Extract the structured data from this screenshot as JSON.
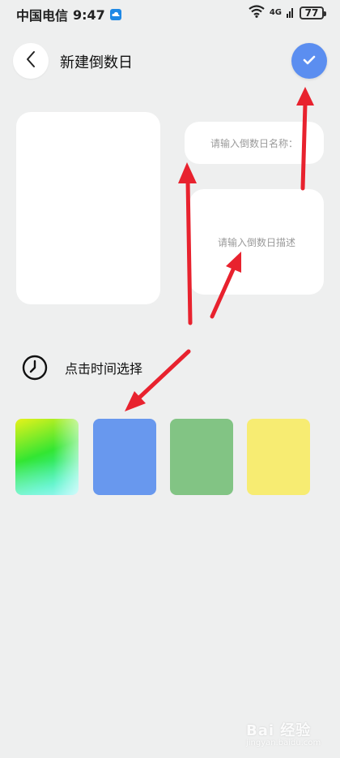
{
  "status_bar": {
    "carrier": "中国电信",
    "time": "9:47",
    "network": "4G",
    "battery": "77"
  },
  "header": {
    "title": "新建倒数日"
  },
  "form": {
    "name_placeholder": "请输入倒数日名称：",
    "description_placeholder": "请输入倒数日描述"
  },
  "time_picker": {
    "label": "点击时间选择"
  },
  "color_options": [
    {
      "name": "gradient",
      "color": "#35e87a"
    },
    {
      "name": "blue",
      "color": "#6898ee"
    },
    {
      "name": "green",
      "color": "#82c484"
    },
    {
      "name": "yellow",
      "color": "#f7ec72"
    }
  ],
  "colors": {
    "accent": "#5b8ef0",
    "background": "#eeefef",
    "annotation_arrow": "#e8222e"
  },
  "watermark": {
    "main": "Bai 经验",
    "sub": "jingyan.baidu.com"
  }
}
